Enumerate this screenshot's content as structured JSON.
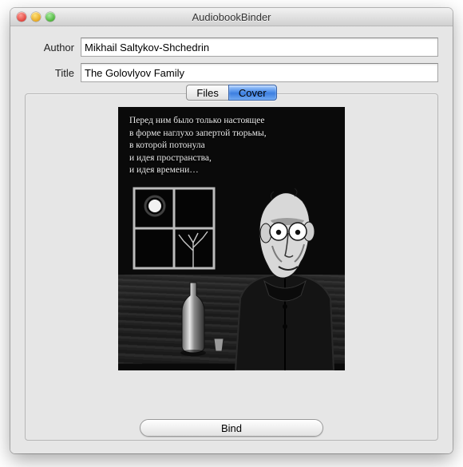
{
  "window": {
    "title": "AudiobookBinder"
  },
  "form": {
    "author_label": "Author",
    "author_value": "Mikhail Saltykov-Shchedrin",
    "title_label": "Title",
    "title_value": "The Golovlyov Family"
  },
  "tabs": {
    "files": "Files",
    "cover": "Cover",
    "selected": "cover"
  },
  "cover": {
    "text": "Перед ним было только настоящее\nв форме наглухо запертой тюрьмы,\nв которой потонула\nи идея пространства,\nи идея времени…"
  },
  "actions": {
    "bind": "Bind"
  }
}
